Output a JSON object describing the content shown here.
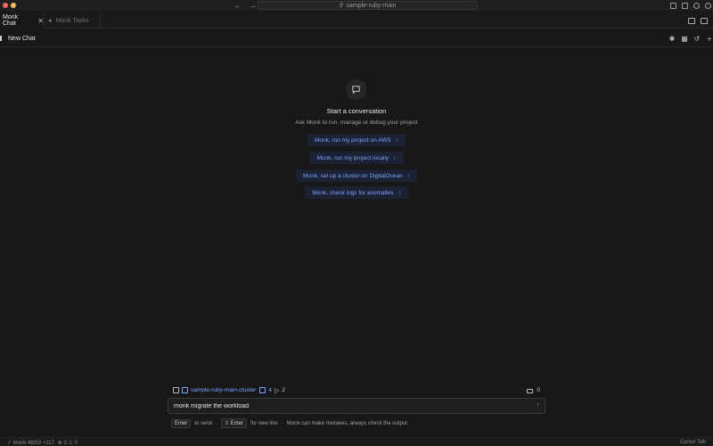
{
  "window": {
    "search_text": "sample-ruby-main"
  },
  "tabs": [
    {
      "label": "Monk Chat",
      "active": true
    },
    {
      "label": "Monk Tasks",
      "active": false
    }
  ],
  "header": {
    "title": "New Chat"
  },
  "empty_state": {
    "title": "Start a conversation",
    "subtitle": "Ask Monk to run, manage or debug your project",
    "suggestions": [
      "Monk, run my project on AWS",
      "Monk, run my project locally",
      "Monk, set up a cluster on DigitalOcean",
      "Monk, check logs for anomalies"
    ]
  },
  "context": {
    "cluster": "sample-ruby-main-cluster",
    "count_a": "4",
    "count_b": "2",
    "locks": "0"
  },
  "input": {
    "value": "monk migrate the workload"
  },
  "hints": {
    "enter_key": "Enter",
    "enter_text": "to send",
    "sep": "·",
    "newline_key": "⇧ Enter",
    "newline_text": "for new line",
    "disclaimer": "Monk can make mistakes, always check the output."
  },
  "status": {
    "left": "✓ Monk 48/50 +117",
    "problems": "⊗ 0 ⚠ 0",
    "right": "Cursor Tab"
  },
  "colors": {
    "background": "#181818",
    "accent": "#7aa2ff",
    "suggestion_bg": "#1c2233"
  }
}
